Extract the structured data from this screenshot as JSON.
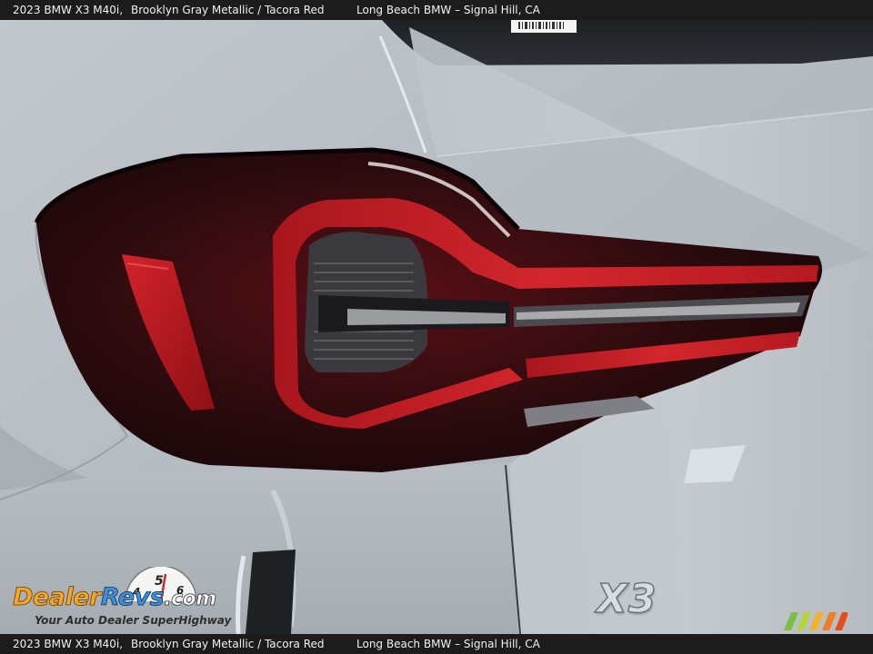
{
  "caption": {
    "model": "2023 BMW X3 M40i,",
    "colors": "Brooklyn Gray Metallic / Tacora Red",
    "dealer": "Long Beach BMW – Signal Hill, CA"
  },
  "watermark": {
    "brand_part1": "Dealer",
    "brand_part2": "Revs",
    "brand_part3": ".com",
    "tagline": "Your Auto Dealer SuperHighway",
    "gauge_digits": [
      "4",
      "5",
      "6"
    ]
  },
  "badge": {
    "model_badge": "X3"
  },
  "colors": {
    "body_paint": "#b9bfc4",
    "taillight_red": "#c81e24",
    "lens_smoke": "#2a0d10",
    "caption_bar": "#1c1c1c",
    "stripe_colors": [
      "#7ac043",
      "#b5d33a",
      "#f0b22a",
      "#ef7d22",
      "#e84b1e"
    ]
  }
}
